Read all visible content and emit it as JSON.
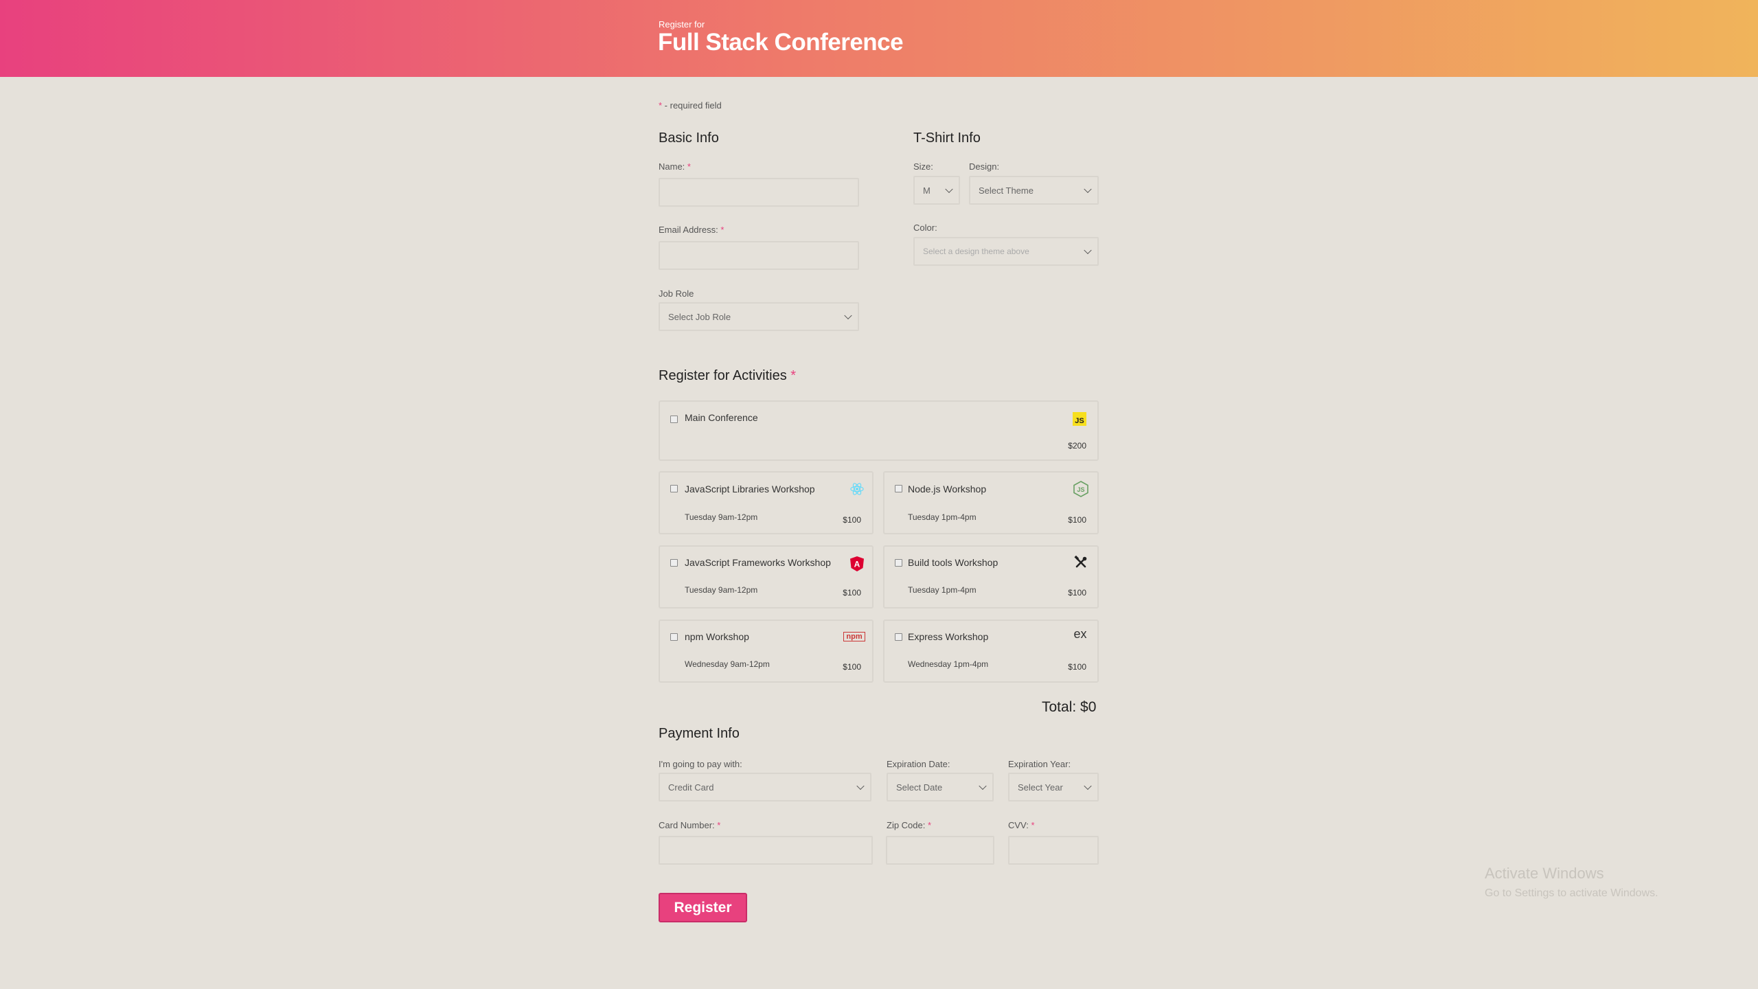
{
  "header": {
    "subtitle": "Register for",
    "title": "Full Stack Conference"
  },
  "required_note": {
    "star": "*",
    "text": " - required field"
  },
  "basic": {
    "title": "Basic Info",
    "name_label": "Name:",
    "email_label": "Email Address:",
    "job_label": "Job Role",
    "job_value": "Select Job Role"
  },
  "shirt": {
    "title": "T-Shirt Info",
    "size_label": "Size:",
    "size_value": "M",
    "design_label": "Design:",
    "design_value": "Select Theme",
    "color_label": "Color:",
    "color_value": "Select a design theme above"
  },
  "activities": {
    "title": "Register for Activities",
    "star": "*",
    "main": {
      "name": "Main Conference",
      "cost": "$200",
      "icon": "javascript-icon",
      "icon_text": "JS",
      "icon_color": "#f7df1e"
    },
    "items": [
      {
        "name": "JavaScript Libraries Workshop",
        "time": "Tuesday 9am-12pm",
        "cost": "$100",
        "icon": "react-icon",
        "icon_color": "#61dafb"
      },
      {
        "name": "Node.js Workshop",
        "time": "Tuesday 1pm-4pm",
        "cost": "$100",
        "icon": "nodejs-icon",
        "icon_color": "#68a063"
      },
      {
        "name": "JavaScript Frameworks Workshop",
        "time": "Tuesday 9am-12pm",
        "cost": "$100",
        "icon": "angular-icon",
        "icon_color": "#dd0031"
      },
      {
        "name": "Build tools Workshop",
        "time": "Tuesday 1pm-4pm",
        "cost": "$100",
        "icon": "tools-icon",
        "icon_color": "#222222"
      },
      {
        "name": "npm Workshop",
        "time": "Wednesday 9am-12pm",
        "cost": "$100",
        "icon": "npm-icon",
        "icon_text": "npm",
        "icon_color": "#cb3837"
      },
      {
        "name": "Express Workshop",
        "time": "Wednesday 1pm-4pm",
        "cost": "$100",
        "icon": "express-icon",
        "icon_text": "ex",
        "icon_color": "#333333"
      }
    ],
    "total": "Total: $0"
  },
  "payment": {
    "title": "Payment Info",
    "method_label": "I'm going to pay with:",
    "method_value": "Credit Card",
    "exp_date_label": "Expiration Date:",
    "exp_date_value": "Select Date",
    "exp_year_label": "Expiration Year:",
    "exp_year_value": "Select Year",
    "card_label": "Card Number:",
    "zip_label": "Zip Code:",
    "cvv_label": "CVV:"
  },
  "register_button": "Register",
  "watermark": {
    "line1": "Activate Windows",
    "line2": "Go to Settings to activate Windows."
  },
  "colors": {
    "accent": "#e8417e",
    "gradient_end": "#f0b45b"
  }
}
